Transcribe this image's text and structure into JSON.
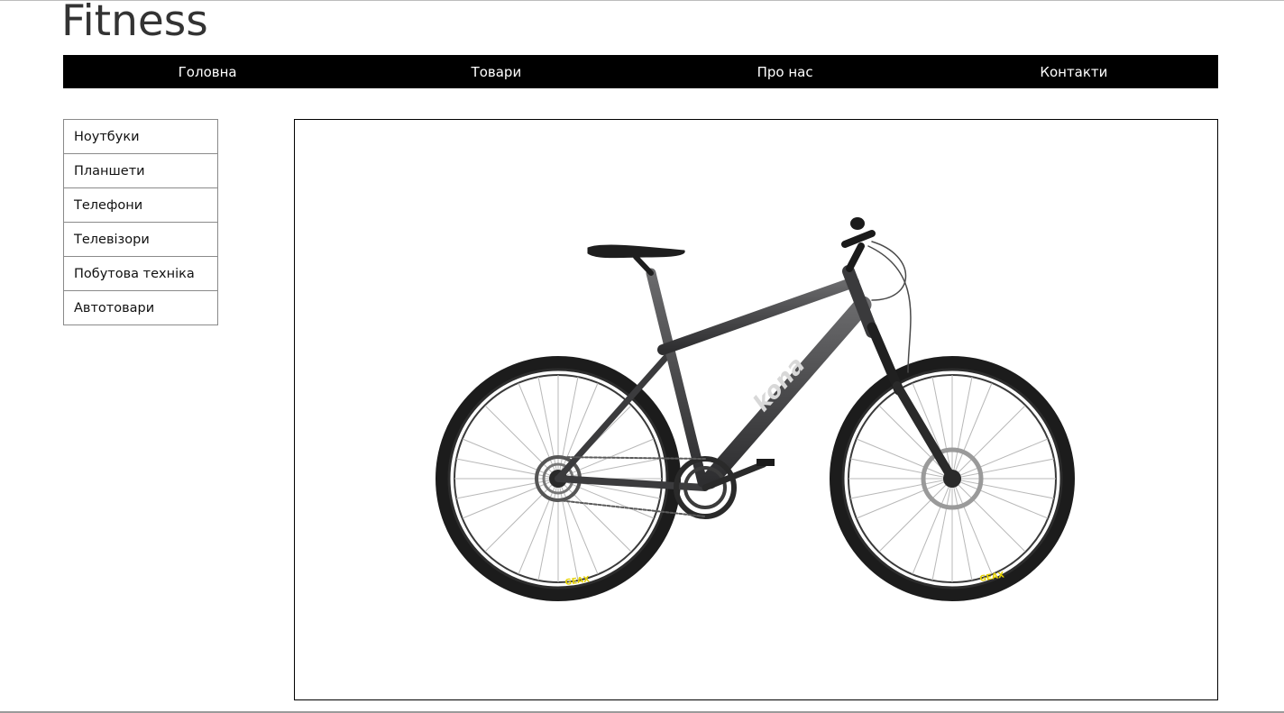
{
  "site": {
    "title": "Fitness"
  },
  "nav": {
    "items": [
      {
        "label": "Головна"
      },
      {
        "label": "Товари"
      },
      {
        "label": "Про нас"
      },
      {
        "label": "Контакти"
      }
    ]
  },
  "sidebar": {
    "items": [
      {
        "label": "Ноутбуки"
      },
      {
        "label": "Планшети"
      },
      {
        "label": "Телефони"
      },
      {
        "label": "Телевізори"
      },
      {
        "label": "Побутова техніка"
      },
      {
        "label": "Автотовари"
      }
    ]
  },
  "product": {
    "image_subject": "mountain-bike",
    "frame_brand_text": "kona",
    "tire_brand_text": "GEAX",
    "colors": {
      "frame": "#4a4a4c",
      "tire": "#1c1c1c",
      "tire_logo": "#e6d200",
      "nav_bg": "#000000",
      "nav_text": "#ffffff"
    }
  }
}
